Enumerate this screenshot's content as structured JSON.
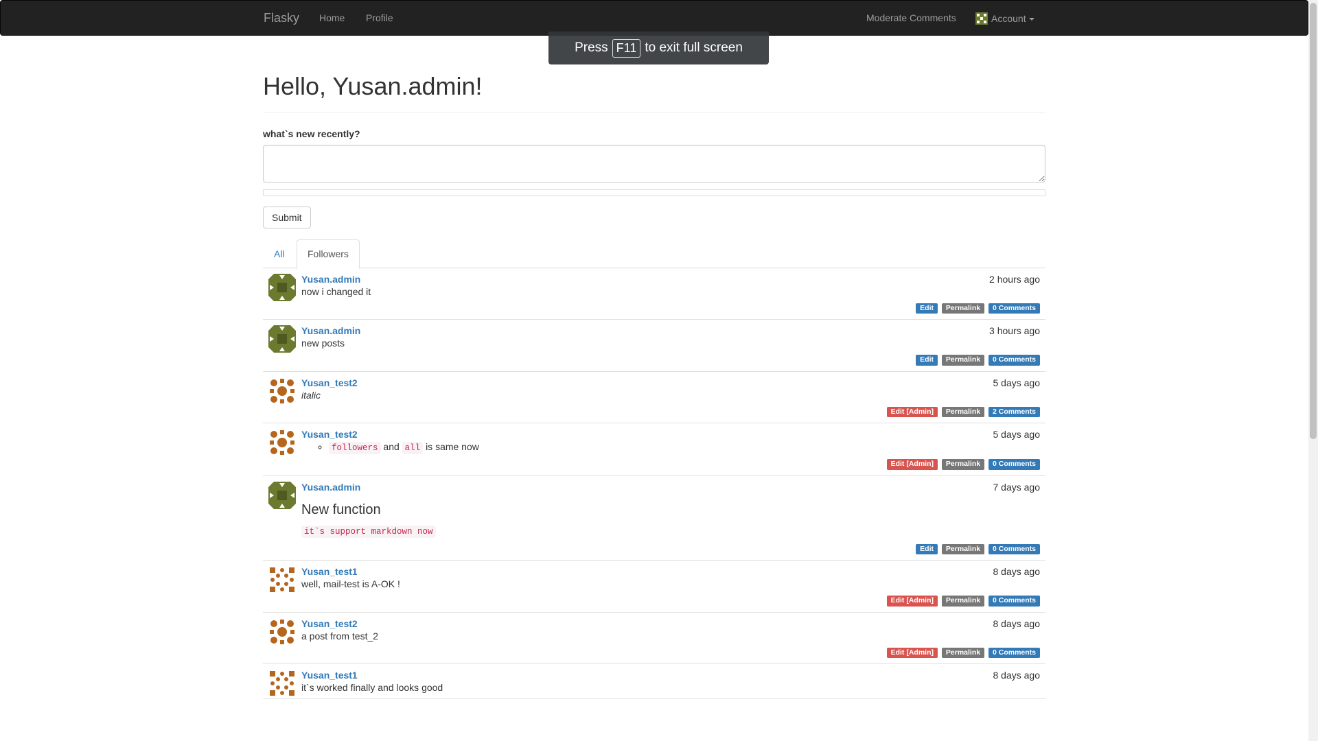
{
  "nav": {
    "brand": "Flasky",
    "home": "Home",
    "profile": "Profile",
    "moderate": "Moderate Comments",
    "account": "Account"
  },
  "fullscreen_toast": {
    "press": "Press",
    "key": "F11",
    "rest": "to exit full screen"
  },
  "page": {
    "greeting": "Hello, Yusan.admin!",
    "form_label": "what`s new recently?",
    "textarea_value": "",
    "submit_label": "Submit"
  },
  "tabs": [
    {
      "label": "All",
      "active": false
    },
    {
      "label": "Followers",
      "active": true
    }
  ],
  "labels": {
    "edit": "Edit",
    "edit_admin": "Edit [Admin]",
    "permalink": "Permalink"
  },
  "posts": [
    {
      "author": "Yusan.admin",
      "date": "2 hours ago",
      "body": "now i changed it",
      "edit": "Edit",
      "comments": "0 Comments"
    },
    {
      "author": "Yusan.admin",
      "date": "3 hours ago",
      "body": "new posts",
      "edit": "Edit",
      "comments": "0 Comments"
    },
    {
      "author": "Yusan_test2",
      "date": "5 days ago",
      "body": "italic",
      "edit": "Edit [Admin]",
      "comments": "2 Comments"
    },
    {
      "author": "Yusan_test2",
      "date": "5 days ago",
      "body_code1": "followers",
      "body_and": "and",
      "body_code2": "all",
      "body_rest": "is same now",
      "edit": "Edit [Admin]",
      "comments": "0 Comments"
    },
    {
      "author": "Yusan.admin",
      "date": "7 days ago",
      "heading": "New function",
      "code": "it`s support markdown now",
      "edit": "Edit",
      "comments": "0 Comments"
    },
    {
      "author": "Yusan_test1",
      "date": "8 days ago",
      "body": "well, mail-test is A-OK !",
      "edit": "Edit [Admin]",
      "comments": "0 Comments"
    },
    {
      "author": "Yusan_test2",
      "date": "8 days ago",
      "body": "a post from test_2",
      "edit": "Edit [Admin]",
      "comments": "0 Comments"
    },
    {
      "author": "Yusan_test1",
      "date": "8 days ago",
      "body": "it`s worked finally and looks good"
    }
  ],
  "colors": {
    "navbar": "#222222",
    "link": "#337ab7",
    "label_primary": "#337ab7",
    "label_default": "#777777",
    "label_danger": "#d9534f",
    "avatar_admin": "#6b7a2e",
    "avatar_test": "#b5651d"
  }
}
